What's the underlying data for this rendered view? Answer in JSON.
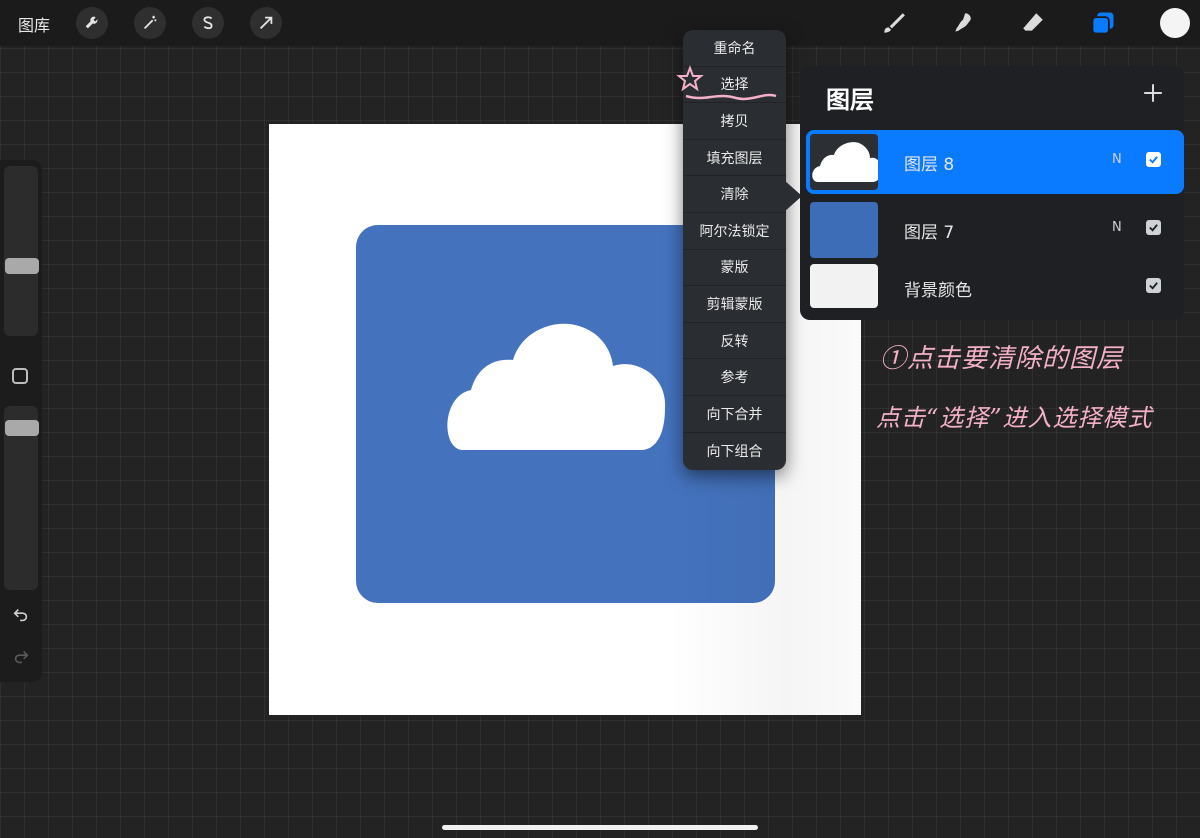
{
  "topbar": {
    "gallery_label": "图库",
    "left_tools": [
      "wrench-icon",
      "magic-wand-icon",
      "selection-s-icon",
      "transform-arrow-icon"
    ],
    "right_tools": [
      "brush-icon",
      "smudge-icon",
      "eraser-icon",
      "layers-icon"
    ],
    "color_swatch": "#f4f4f4",
    "accent": "#0a7bff"
  },
  "sidebar": {
    "undo_icon": "undo-icon",
    "redo_icon": "redo-icon"
  },
  "menu": {
    "items": [
      "重命名",
      "选择",
      "拷贝",
      "填充图层",
      "清除",
      "阿尔法锁定",
      "蒙版",
      "剪辑蒙版",
      "反转",
      "参考",
      "向下合并",
      "向下组合"
    ]
  },
  "layers": {
    "title": "图层",
    "add_icon": "plus-icon",
    "rows": [
      {
        "name": "图层 8",
        "mode": "N",
        "checked": true,
        "active": true
      },
      {
        "name": "图层 7",
        "mode": "N",
        "checked": true,
        "active": false
      },
      {
        "name": "背景颜色",
        "mode": "",
        "checked": true,
        "active": false
      }
    ]
  },
  "annotations": {
    "line1": "①点击要清除的图层",
    "line2": "点击“选择”进入选择模式",
    "color": "#f4b0c6"
  },
  "canvas": {
    "background": "#ffffff",
    "shape_color": "#4472bd"
  }
}
